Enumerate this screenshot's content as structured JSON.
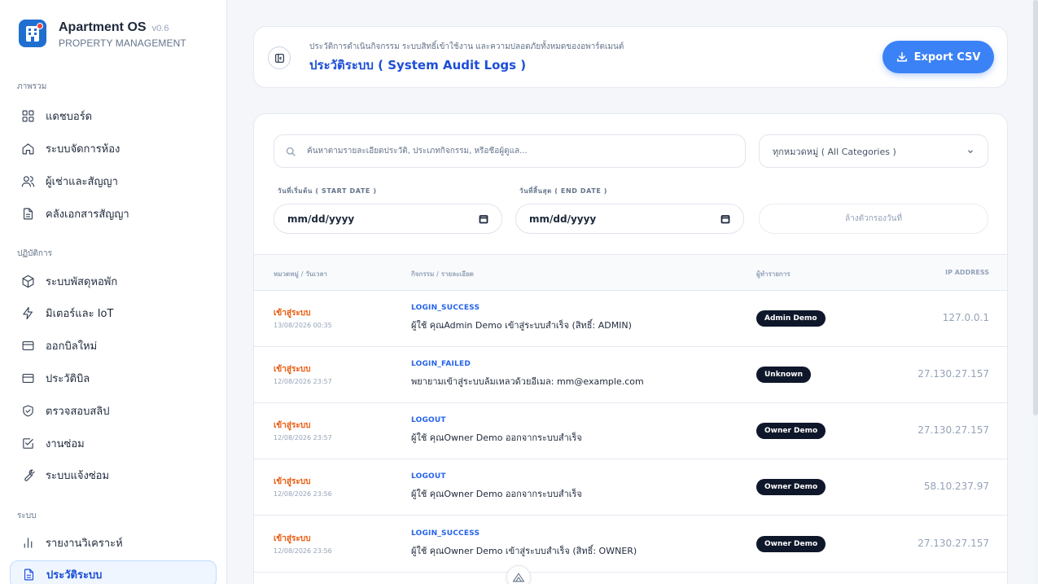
{
  "brand": {
    "name": "Apartment OS",
    "version": "v0.6",
    "subtitle": "PROPERTY MANAGEMENT"
  },
  "sidebar": {
    "sections": [
      {
        "title": "ภาพรวม"
      },
      {
        "title": "ปฏิบัติการ"
      },
      {
        "title": "ระบบ"
      }
    ],
    "items": [
      {
        "label": "แดชบอร์ด",
        "icon": "grid-icon"
      },
      {
        "label": "ระบบจัดการห้อง",
        "icon": "home-icon"
      },
      {
        "label": "ผู้เช่าและสัญญา",
        "icon": "users-icon"
      },
      {
        "label": "คลังเอกสารสัญญา",
        "icon": "document-icon"
      },
      {
        "label": "ระบบพัสดุหอพัก",
        "icon": "package-icon"
      },
      {
        "label": "มิเตอร์และ IoT",
        "icon": "bolt-icon"
      },
      {
        "label": "ออกบิลใหม่",
        "icon": "card-icon"
      },
      {
        "label": "ประวัติบิล",
        "icon": "card-icon"
      },
      {
        "label": "ตรวจสอบสลิป",
        "icon": "shield-check-icon"
      },
      {
        "label": "งานซ่อม",
        "icon": "checkbox-icon"
      },
      {
        "label": "ระบบแจ้งซ่อม",
        "icon": "wrench-icon"
      },
      {
        "label": "รายงานวิเคราะห์",
        "icon": "bar-chart-icon"
      },
      {
        "label": "ประวัติระบบ",
        "icon": "document-icon",
        "active": true
      }
    ]
  },
  "header": {
    "subtitle": "ประวัติการดำเนินกิจกรรม ระบบสิทธิ์เข้าใช้งาน และความปลอดภัยทั้งหมดของอพาร์ตเมนต์",
    "title": "ประวัติระบบ ( System Audit Logs )",
    "export_label": "Export CSV"
  },
  "filters": {
    "search_placeholder": "ค้นหาตามรายละเอียดประวัติ, ประเภทกิจกรรม, หรือชื่อผู้ดูแล...",
    "category_selected": "ทุกหมวดหมู่ ( All Categories )",
    "start_label": "วันที่เริ่มต้น ( START DATE )",
    "end_label": "วันที่สิ้นสุด ( END DATE )",
    "start_value": "mm/dd/yyyy",
    "end_value": "mm/dd/yyyy",
    "clear_label": "ล้างตัวกรองวันที่"
  },
  "table": {
    "headers": [
      "หมวดหมู่ / วันเวลา",
      "กิจกรรม / รายละเอียด",
      "ผู้ทำรายการ",
      "IP ADDRESS"
    ],
    "rows": [
      {
        "category": "เข้าสู่ระบบ",
        "time": "13/08/2026 00:35",
        "action": "LOGIN_SUCCESS",
        "detail": "ผู้ใช้ คุณAdmin Demo เข้าสู่ระบบสำเร็จ (สิทธิ์: ADMIN)",
        "user": "Admin Demo",
        "ip": "127.0.0.1"
      },
      {
        "category": "เข้าสู่ระบบ",
        "time": "12/08/2026 23:57",
        "action": "LOGIN_FAILED",
        "detail": "พยายามเข้าสู่ระบบล้มเหลวด้วยอีเมล: mm@example.com",
        "user": "Unknown",
        "ip": "27.130.27.157"
      },
      {
        "category": "เข้าสู่ระบบ",
        "time": "12/08/2026 23:57",
        "action": "LOGOUT",
        "detail": "ผู้ใช้ คุณOwner Demo ออกจากระบบสำเร็จ",
        "user": "Owner Demo",
        "ip": "27.130.27.157"
      },
      {
        "category": "เข้าสู่ระบบ",
        "time": "12/08/2026 23:56",
        "action": "LOGOUT",
        "detail": "ผู้ใช้ คุณOwner Demo ออกจากระบบสำเร็จ",
        "user": "Owner Demo",
        "ip": "58.10.237.97"
      },
      {
        "category": "เข้าสู่ระบบ",
        "time": "12/08/2026 23:56",
        "action": "LOGIN_SUCCESS",
        "detail": "ผู้ใช้ คุณOwner Demo เข้าสู่ระบบสำเร็จ (สิทธิ์: OWNER)",
        "user": "Owner Demo",
        "ip": "27.130.27.157"
      }
    ]
  },
  "colors": {
    "primary": "#3b82f6",
    "accent_text": "#1d4ed8",
    "category": "#ea580c",
    "badge": "#0f172a"
  }
}
